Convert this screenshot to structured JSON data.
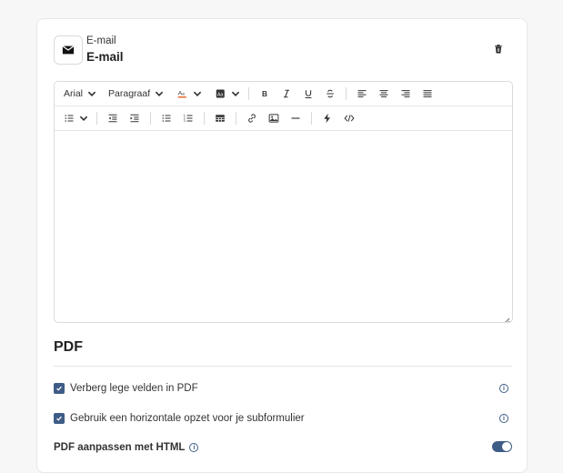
{
  "header": {
    "subtitle": "E-mail",
    "title": "E-mail",
    "mail_icon": "envelope-icon",
    "delete_icon": "trash-icon"
  },
  "toolbar": {
    "font": "Arial",
    "block_format": "Paragraaf",
    "row1_icons": [
      "text-color-icon",
      "highlight-icon",
      "bold-icon",
      "italic-icon",
      "underline-icon",
      "strikethrough-icon",
      "align-left-icon",
      "align-center-icon",
      "align-right-icon",
      "align-justify-icon"
    ],
    "row2_icons": [
      "list-style-icon",
      "outdent-icon",
      "indent-icon",
      "bullet-list-icon",
      "numbered-list-icon",
      "table-icon",
      "link-icon",
      "image-icon",
      "horizontal-rule-icon",
      "lightning-icon",
      "code-icon"
    ]
  },
  "pdf": {
    "title": "PDF",
    "options": [
      {
        "label": "Verberg lege velden in PDF",
        "checked": true
      },
      {
        "label": "Gebruik een horizontale opzet voor je subformulier",
        "checked": true
      }
    ],
    "html_label": "PDF aanpassen met HTML",
    "html_toggle_on": true
  },
  "colors": {
    "accent": "#3f5c86"
  }
}
